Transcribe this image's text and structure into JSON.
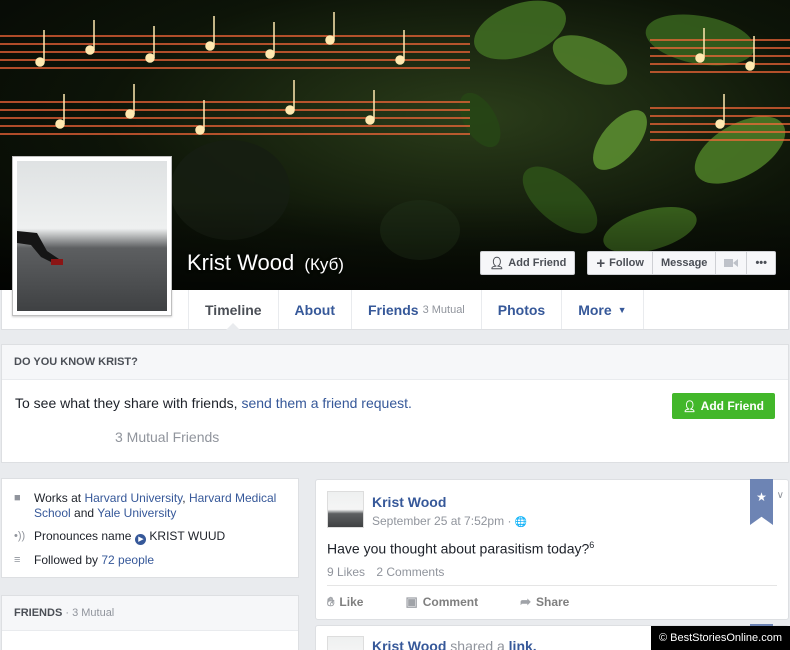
{
  "profile": {
    "name": "Krist Wood",
    "alt_name": "(Куб)"
  },
  "cover_actions": {
    "add_friend": "Add Friend",
    "follow": "Follow",
    "message": "Message",
    "more": "•••"
  },
  "nav": {
    "tabs": [
      {
        "label": "Timeline"
      },
      {
        "label": "About"
      },
      {
        "label": "Friends",
        "sub": "3 Mutual"
      },
      {
        "label": "Photos"
      },
      {
        "label": "More"
      }
    ]
  },
  "know_card": {
    "heading": "DO YOU KNOW KRIST?",
    "text": "To see what they share with friends,",
    "link": "send them a friend request.",
    "button": "Add Friend",
    "mutual": "3 Mutual Friends"
  },
  "intro": {
    "works_prefix": "Works at",
    "works_1": "Harvard University",
    "works_sep": ",",
    "works_2": "Harvard Medical School",
    "works_and": "and",
    "works_3": "Yale University",
    "pronounce_label": "Pronounces name",
    "pronounce_value": "KRIST WUUD",
    "followed_prefix": "Followed by",
    "followed_link": "72 people"
  },
  "friends_box": {
    "heading": "FRIENDS",
    "sub": "· 3 Mutual"
  },
  "post": {
    "author": "Krist Wood",
    "time": "September 25 at 7:52pm",
    "separator": "·",
    "globe_icon": "🌐",
    "text": "Have you thought about parasitism today?",
    "sup": "6",
    "likes": "9 Likes",
    "comments": "2 Comments",
    "actions": [
      "Like",
      "Comment",
      "Share"
    ]
  },
  "post2": {
    "author": "Krist Wood",
    "middle": "shared a",
    "link": "link."
  },
  "watermark": "© BestStoriesOnline.com"
}
